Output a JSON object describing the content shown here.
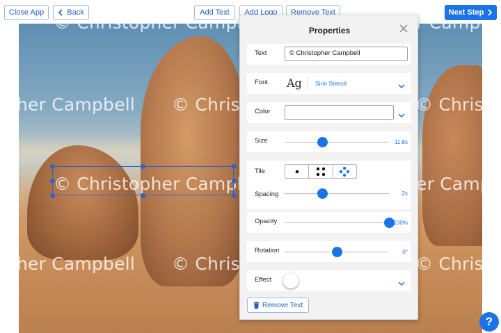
{
  "toolbar": {
    "close_app": "Close App",
    "back": "Back",
    "add_text": "Add Text",
    "add_logo": "Add Logo",
    "remove_text": "Remove Text",
    "next_step": "Next Step"
  },
  "watermark": {
    "text": "© Christopher Campbell",
    "fragment_right": "© Christo",
    "fragment_left": "her Campbell",
    "fragment_right_short": "© Christo"
  },
  "panel": {
    "title": "Properties",
    "text_label": "Text",
    "text_value": "© Christopher Campbell",
    "font_label": "Font",
    "font_preview": "Ag",
    "font_name": "Sirin Stencil",
    "color_label": "Color",
    "size_label": "Size",
    "size_value": "11.8x",
    "size_level": 0.36,
    "tile_label": "Tile",
    "spacing_label": "Spacing",
    "spacing_value": "2x",
    "spacing_level": 0.36,
    "opacity_label": "Opacity",
    "opacity_value": "100%",
    "opacity_level": 1.0,
    "rotation_label": "Rotation",
    "rotation_value": "0°",
    "rotation_level": 0.5,
    "effect_label": "Effect",
    "remove_text": "Remove Text"
  },
  "help": "?",
  "colors": {
    "accent": "#1a73e8",
    "selection": "#2f63c9"
  },
  "icons": [
    "chevron-left-icon",
    "chevron-right-icon",
    "close-icon",
    "chevron-down-icon",
    "trash-icon",
    "help-icon"
  ]
}
